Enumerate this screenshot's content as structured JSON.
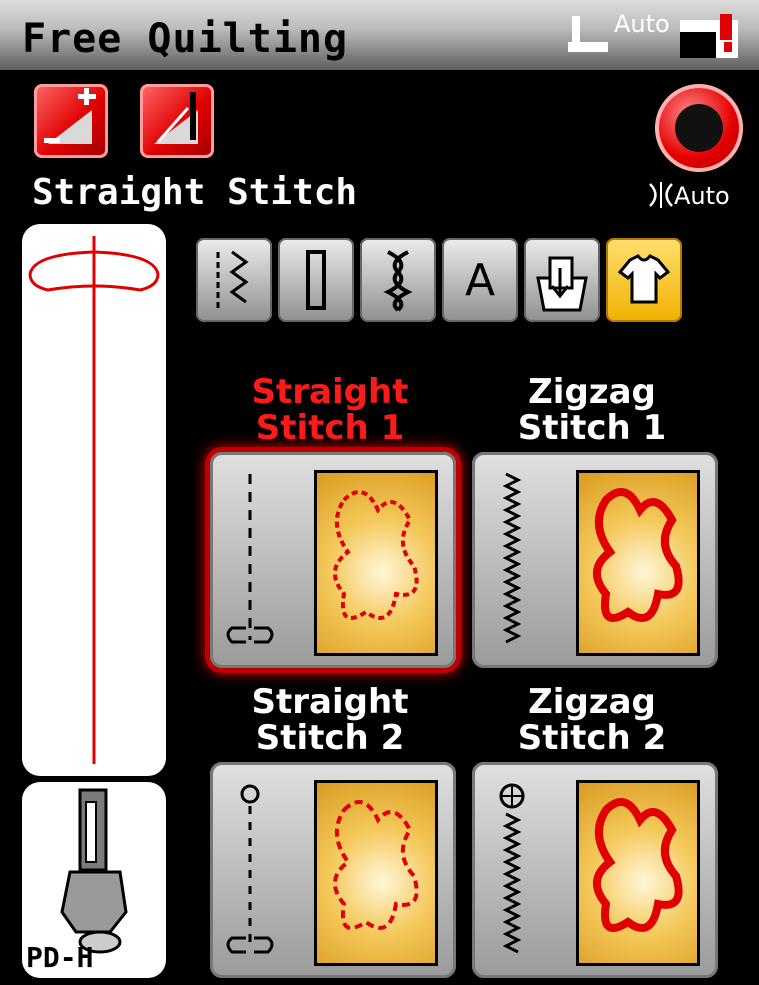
{
  "header": {
    "title": "Free Quilting",
    "auto_label": "Auto"
  },
  "toolbar": {
    "stitch_name": "Straight Stitch",
    "tension_auto_label": "Auto"
  },
  "foot": {
    "label": "PD-H"
  },
  "tabs": [
    {
      "icon": "utility-stitch-icon"
    },
    {
      "icon": "buttonhole-icon"
    },
    {
      "icon": "decorative-stitch-icon"
    },
    {
      "icon": "letter-a-icon",
      "glyph": "A"
    },
    {
      "icon": "memory-folder-icon"
    },
    {
      "icon": "shirt-icon"
    }
  ],
  "stitches": [
    {
      "line1": "Straight",
      "line2": "Stitch 1"
    },
    {
      "line1": "Zigzag",
      "line2": "Stitch 1"
    },
    {
      "line1": "Straight",
      "line2": "Stitch 2"
    },
    {
      "line1": "Zigzag",
      "line2": "Stitch 2"
    }
  ],
  "colors": {
    "accent_red": "#ff1a1a",
    "selected_tab": "#f5c000"
  }
}
